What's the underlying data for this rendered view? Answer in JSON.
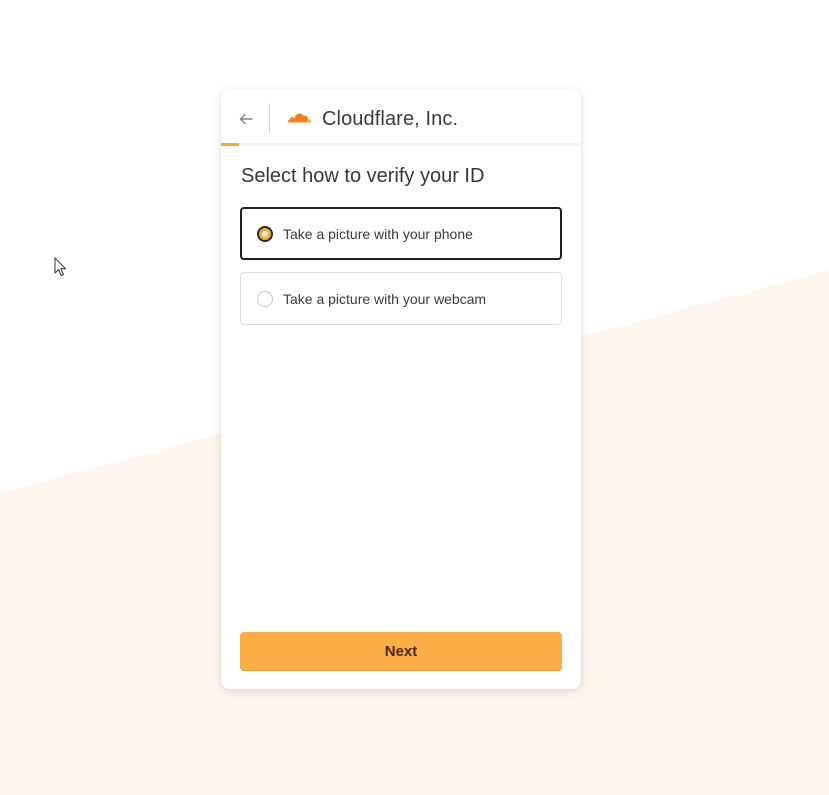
{
  "header": {
    "back_icon": "arrow-left-icon",
    "logo_icon": "cloudflare-cloud-icon",
    "company_name": "Cloudflare, Inc.",
    "progress_fraction": 0.05
  },
  "main": {
    "heading": "Select how to verify your ID",
    "options": [
      {
        "label": "Take a picture with your phone",
        "selected": true
      },
      {
        "label": "Take a picture with your webcam",
        "selected": false
      }
    ],
    "next_label": "Next"
  },
  "colors": {
    "accent": "#f6a93b",
    "button": "#fbae45",
    "background_tint": "#fef6ec",
    "logo_orange": "#f38020",
    "logo_light": "#faae40"
  }
}
